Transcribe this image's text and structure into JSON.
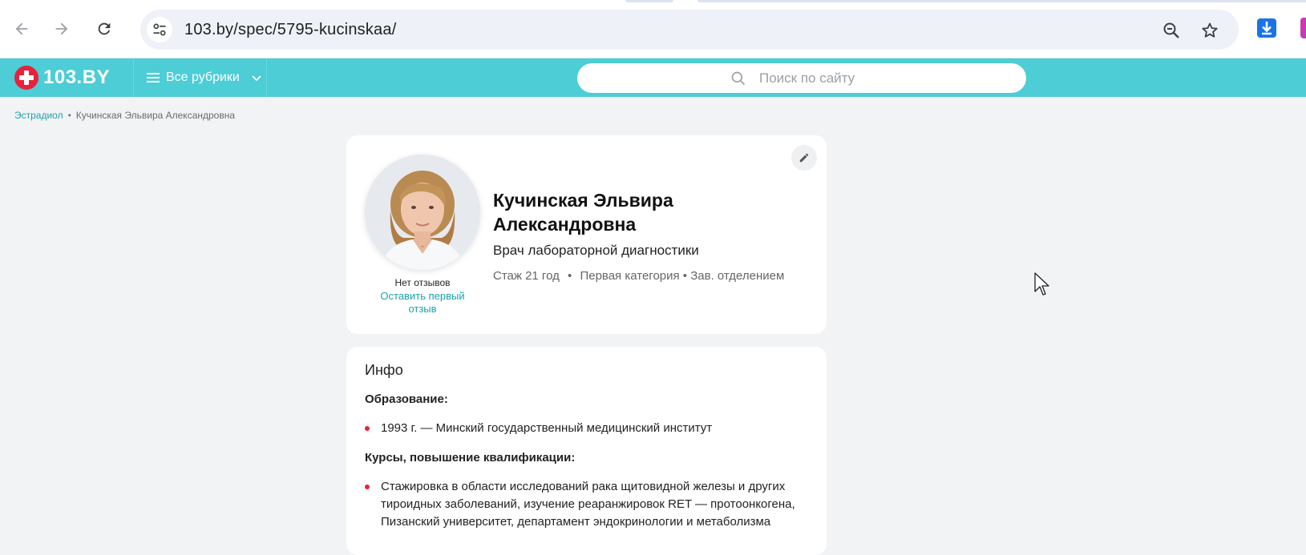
{
  "browser": {
    "url": "103.by/spec/5795-kucinskaa/",
    "icons": {
      "back": "arrow-left-icon",
      "forward": "arrow-right-icon",
      "reload": "reload-icon",
      "site_info": "tune-icon",
      "zoom": "zoom-out-icon",
      "bookmark": "star-icon",
      "download": "download-icon"
    },
    "colors": {
      "toolbar_bg": "#ffffff",
      "omnibox_bg": "#eef1f7",
      "download_accent": "#1a73e8"
    }
  },
  "site_header": {
    "logo_text": "103.BY",
    "rubrics_label": "Все рубрики",
    "search_placeholder": "Поиск по сайту",
    "colors": {
      "header_bg": "#4dcdd6",
      "logo_red": "#e8223a"
    }
  },
  "breadcrumb": {
    "items": [
      {
        "label": "Эстрадиол",
        "link": true
      },
      {
        "label": "Кучинская Эльвира Александровна",
        "link": false
      }
    ],
    "separator": "•"
  },
  "profile": {
    "name_line1": "Кучинская Эльвира",
    "name_line2": "Александровна",
    "specialty": "Врач лабораторной диагностики",
    "experience": "Стаж 21 год",
    "meta_separator": "•",
    "category_and_position": "Первая категория • Зав. отделением",
    "reviews_status": "Нет отзывов",
    "first_review_link": "Оставить первый отзыв",
    "edit_icon": "pencil-icon"
  },
  "info": {
    "title": "Инфо",
    "education_heading": "Образование:",
    "education": [
      "1993 г. — Минский государственный медицинский институт"
    ],
    "courses_heading": "Курсы, повышение квалификации:",
    "courses": [
      "Стажировка в области исследований рака щитовидной железы и других тироидных заболеваний, изучение реаранжировок RET — протоонкогена, Пизанский университет, департамент эндокринологии и метаболизма"
    ]
  }
}
